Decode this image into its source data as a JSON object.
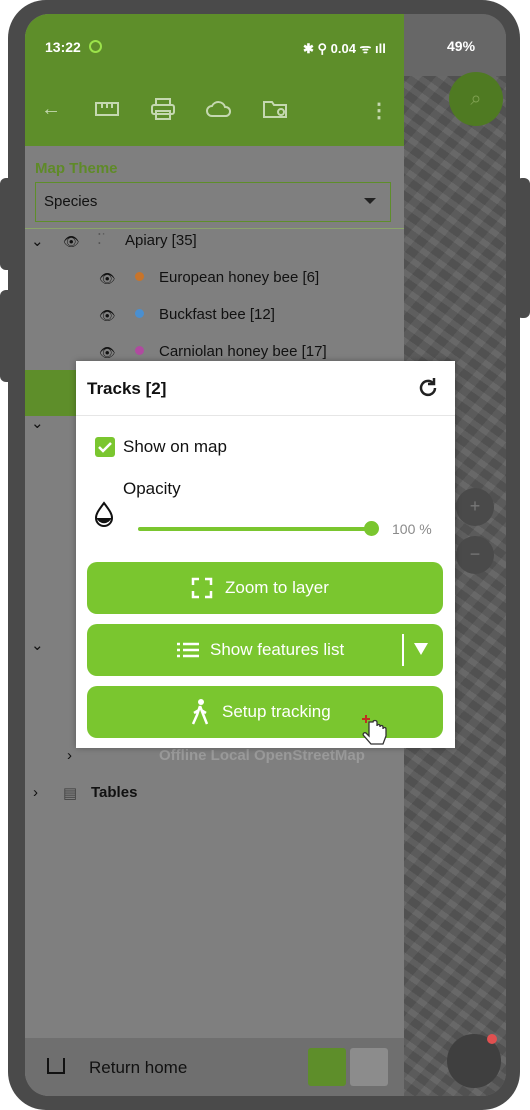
{
  "status": {
    "time": "13:22",
    "system": "✱ ⚲ 0.04 ᯤ ıll",
    "battery": "49%"
  },
  "map_theme": {
    "label": "Map Theme",
    "selected": "Species"
  },
  "tree": {
    "apiary": "Apiary [35]",
    "items": [
      "European honey bee [6]",
      "Buckfast bee [12]",
      "Carniolan honey bee [17]"
    ],
    "colors": [
      "#c8742a",
      "#4a8fd0",
      "#b04aa0"
    ],
    "offline": "Offline Local OpenStreetMap",
    "tables": "Tables"
  },
  "dialog": {
    "title": "Tracks [2]",
    "show_on_map": "Show on map",
    "opacity_label": "Opacity",
    "opacity_value": "100 %",
    "zoom_label": "Zoom to layer",
    "features_label": "Show features list",
    "tracking_label": "Setup tracking"
  },
  "bottom": {
    "return_home": "Return home"
  },
  "colors": {
    "accent": "#7ac62f",
    "toolbar": "#5e8e2a"
  }
}
